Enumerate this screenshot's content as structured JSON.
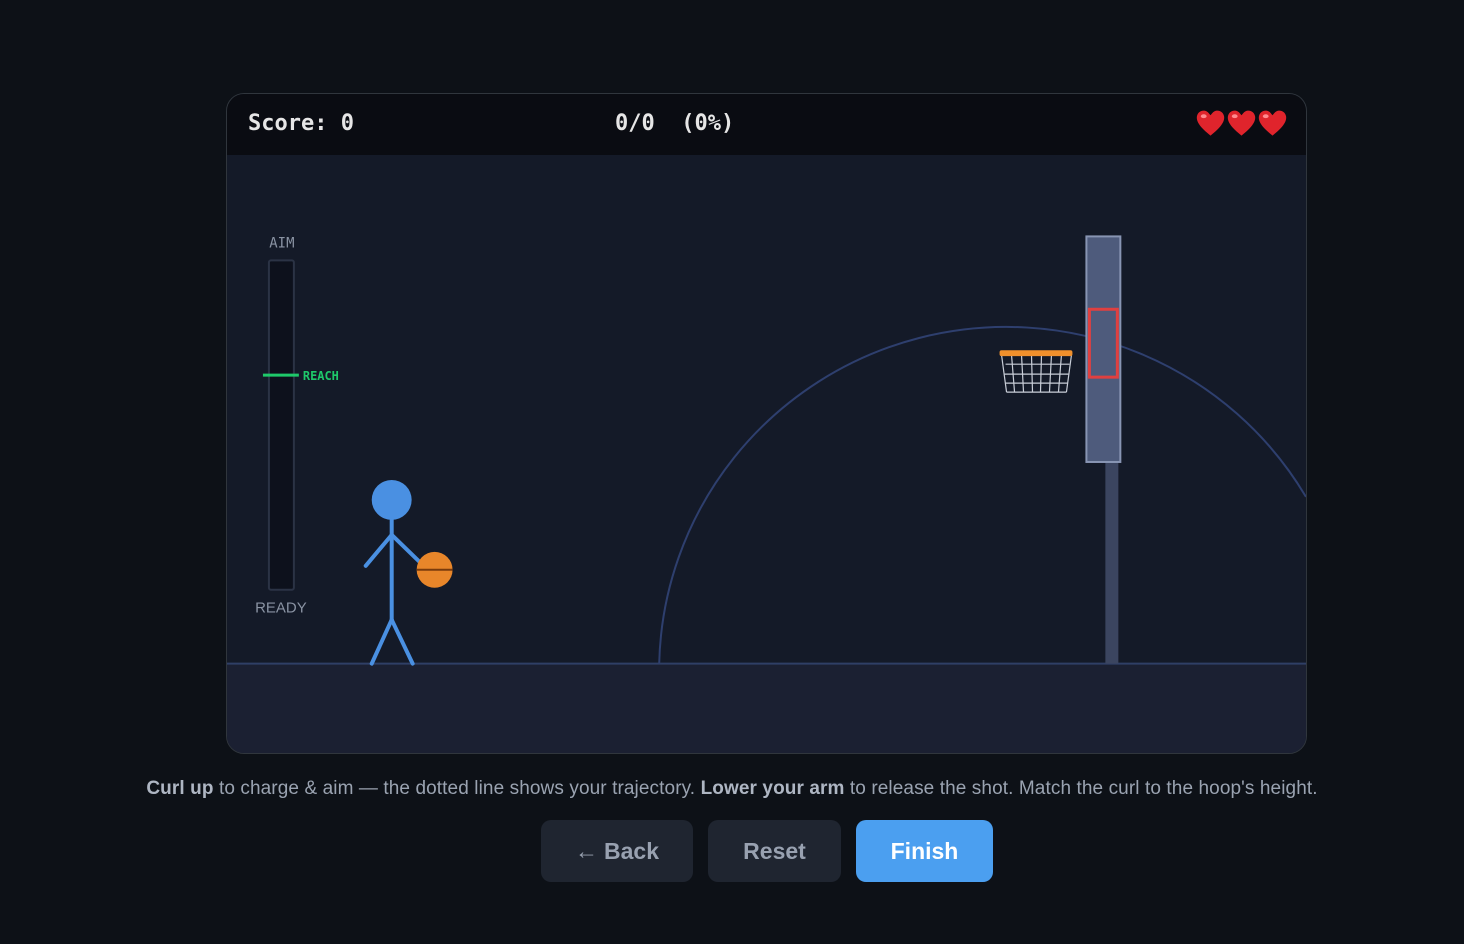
{
  "hud": {
    "score_label": "Score:",
    "score_value": "0",
    "shots_made": "0",
    "shots_total": "0",
    "shot_pct": "(0%)",
    "lives": 3
  },
  "aim_meter": {
    "top_label": "AIM",
    "bottom_label": "READY",
    "target_label": "REACH",
    "fill_level": 0
  },
  "instructions": {
    "part1_bold": "Curl up",
    "part2": " to charge & aim — the dotted line shows your trajectory. ",
    "part3_bold": "Lower your arm",
    "part4": " to release the shot. Match the curl to the hoop's height."
  },
  "buttons": {
    "back_arrow": "←",
    "back_label": "Back",
    "reset_label": "Reset",
    "finish_label": "Finish"
  },
  "colors": {
    "player": "#4a90e2",
    "ball": "#e8862a",
    "rim": "#f0902c",
    "target_box": "#e04040",
    "reach_marker": "#1ec96a",
    "finish_button": "#4b9ff0"
  }
}
